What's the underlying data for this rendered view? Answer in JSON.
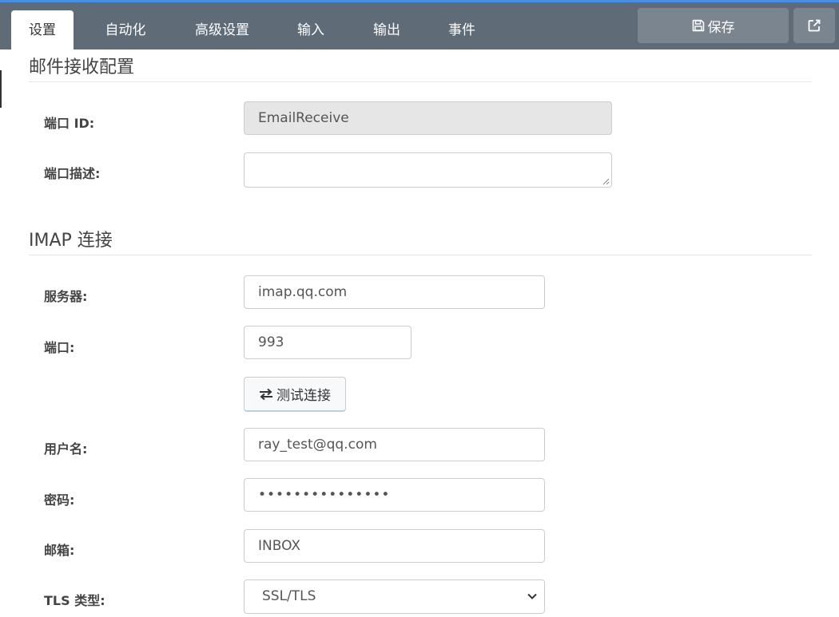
{
  "tabs": [
    {
      "label": "设置",
      "active": true
    },
    {
      "label": "自动化",
      "active": false
    },
    {
      "label": "高级设置",
      "active": false
    },
    {
      "label": "输入",
      "active": false
    },
    {
      "label": "输出",
      "active": false
    },
    {
      "label": "事件",
      "active": false
    }
  ],
  "toolbar": {
    "save_label": "保存",
    "save_icon": "floppy-disk-icon",
    "external_icon": "external-link-icon"
  },
  "colors": {
    "topbar": "#5f6b77",
    "button": "#7b858f",
    "accent": "#4a8fe0"
  },
  "sections": {
    "mail_receive": {
      "title": "邮件接收配置",
      "port_id_label": "端口 ID:",
      "port_id_value": "EmailReceive",
      "port_desc_label": "端口描述:",
      "port_desc_value": ""
    },
    "imap": {
      "title": "IMAP 连接",
      "server_label": "服务器:",
      "server_value": "imap.qq.com",
      "port_label": "端口:",
      "port_value": "993",
      "test_button_label": "测试连接",
      "test_button_icon": "exchange-arrows-icon",
      "username_label": "用户名:",
      "username_value": "ray_test@qq.com",
      "password_label": "密码:",
      "password_value": "•••••••••••••••",
      "mailbox_label": "邮箱:",
      "mailbox_value": "INBOX",
      "tls_label": "TLS 类型:",
      "tls_value": "SSL/TLS"
    }
  }
}
